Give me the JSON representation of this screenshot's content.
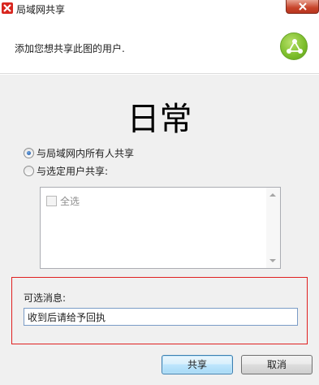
{
  "window": {
    "title": "局域网共享"
  },
  "header": {
    "description": "添加您想共享此图的用户."
  },
  "main": {
    "title": "日常",
    "share_options": [
      {
        "label": "与局域网内所有人共享",
        "selected": true
      },
      {
        "label": "与选定用户共享:",
        "selected": false
      }
    ],
    "user_list": {
      "select_all_label": "全选",
      "select_all_checked": false
    },
    "message": {
      "label": "可选消息:",
      "value": "收到后请给予回执"
    }
  },
  "buttons": {
    "share": "共享",
    "cancel": "取消"
  },
  "colors": {
    "highlight_frame": "#e02020",
    "logo_green": "#7bbd2a",
    "close_red": "#c7442a"
  }
}
